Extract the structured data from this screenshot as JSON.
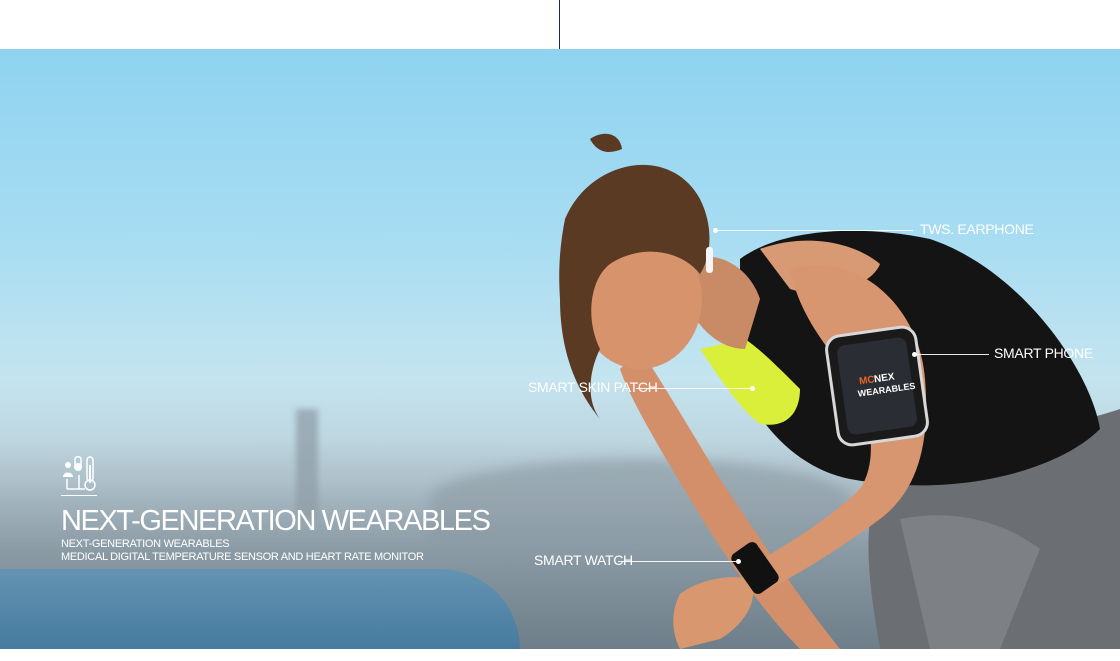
{
  "header": {},
  "hero": {
    "callouts": {
      "earphone": "TWS. EARPHONE",
      "phone": "SMART PHONE",
      "patch": "SMART SKIN PATCH",
      "watch": "SMART WATCH"
    },
    "armband": {
      "brand_a": "MC",
      "brand_b": "NEX",
      "brand_c": "WEARABLES"
    },
    "feature": {
      "icon": "thermometer-person-icon",
      "title": "NEXT-GENERATION WEARABLES",
      "line1": "NEXT-GENERATION WEARABLES",
      "line2": "MEDICAL DIGITAL TEMPERATURE SENSOR AND HEART RATE MONITOR"
    },
    "colors": {
      "sky": "#a6dcf2",
      "accent": "#e8642c",
      "tank_top": "#111111",
      "sports_bra": "#d9ef3a"
    }
  }
}
